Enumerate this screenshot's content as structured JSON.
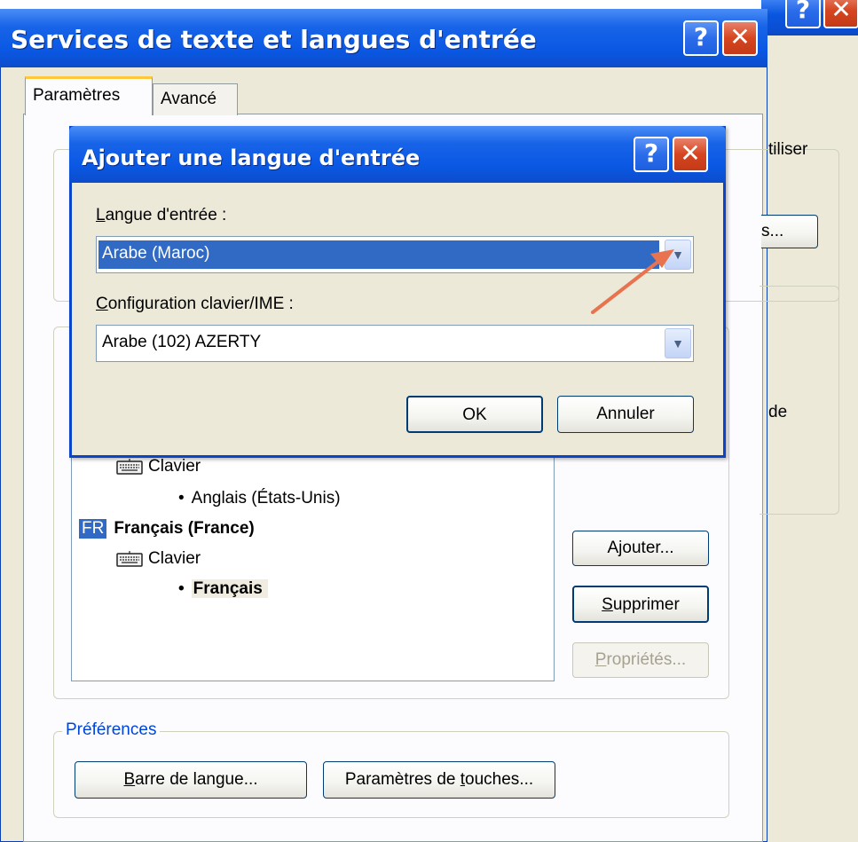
{
  "main_window": {
    "title": "Services de texte et langues d'entrée",
    "help_icon": "?",
    "close_icon": "✕"
  },
  "tabs": [
    {
      "label": "Paramètres",
      "active": true
    },
    {
      "label": "Avancé",
      "active": false
    }
  ],
  "background_fragments": {
    "top_right_text": "tiliser",
    "button_fragment": "s...",
    "side_text": "de"
  },
  "installed_services": {
    "items": [
      {
        "type": "category",
        "icon": "keyboard-icon",
        "label": "Clavier"
      },
      {
        "type": "layout",
        "bullet": "•",
        "label": "Anglais (États-Unis)"
      },
      {
        "type": "language",
        "badge": "FR",
        "label": "Français (France)"
      },
      {
        "type": "category",
        "icon": "keyboard-icon",
        "label": "Clavier"
      },
      {
        "type": "layout",
        "bullet": "•",
        "label": "Français",
        "selected": true
      }
    ]
  },
  "side_buttons": {
    "add": {
      "pre": "A",
      "accel": "j",
      "post": "outer..."
    },
    "remove": {
      "pre": "",
      "accel": "S",
      "post": "upprimer"
    },
    "properties": {
      "pre": "",
      "accel": "P",
      "post": "ropriétés...",
      "disabled": true
    }
  },
  "preferences": {
    "legend": "Préférences",
    "language_bar": {
      "pre": "",
      "accel": "B",
      "post": "arre de langue..."
    },
    "key_settings": {
      "pre": "Paramètres de ",
      "accel": "t",
      "post": "ouches..."
    }
  },
  "dialog": {
    "title": "Ajouter une langue d'entrée",
    "input_language_label": {
      "accel": "L",
      "post": "angue d'entrée :"
    },
    "input_language_value": "Arabe (Maroc)",
    "keyboard_label": {
      "accel": "C",
      "post": "onfiguration clavier/IME :"
    },
    "keyboard_value": "Arabe (102) AZERTY",
    "ok_label": "OK",
    "cancel_label": "Annuler"
  },
  "colors": {
    "title_bar": "#0a58e4",
    "selection": "#316ac5",
    "annotation_arrow": "#e8734f",
    "legend_text": "#0046d5"
  }
}
